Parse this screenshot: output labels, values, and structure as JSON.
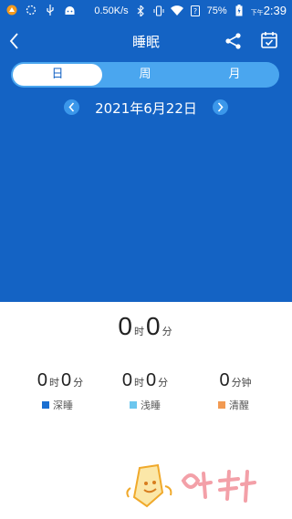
{
  "status_bar": {
    "speed": "0.50K/s",
    "battery": "75%",
    "ampm": "下午",
    "time": "2:39"
  },
  "header": {
    "title": "睡眠",
    "back_icon": "chevron-left-icon",
    "share_icon": "share-icon",
    "calendar_icon": "calendar-icon"
  },
  "tabs": [
    {
      "label": "日",
      "active": true
    },
    {
      "label": "周",
      "active": false
    },
    {
      "label": "月",
      "active": false
    }
  ],
  "date": "2021年6月22日",
  "summary": {
    "hours": "0",
    "hours_unit": "时",
    "minutes": "0",
    "minutes_unit": "分"
  },
  "stats": [
    {
      "hours": "0",
      "hours_unit": "时",
      "minutes": "0",
      "minutes_unit": "分",
      "label": "深睡",
      "color": "#1a6fd1"
    },
    {
      "hours": "0",
      "hours_unit": "时",
      "minutes": "0",
      "minutes_unit": "分",
      "label": "浅睡",
      "color": "#6cc6ee"
    },
    {
      "minutes": "0",
      "minutes_unit": "分钟",
      "label": "清醒",
      "color": "#f29a52"
    }
  ],
  "colors": {
    "header_bg": "#1463c4",
    "tab_bg": "#4aa6ef",
    "arrow_bg": "#3b97ea"
  }
}
